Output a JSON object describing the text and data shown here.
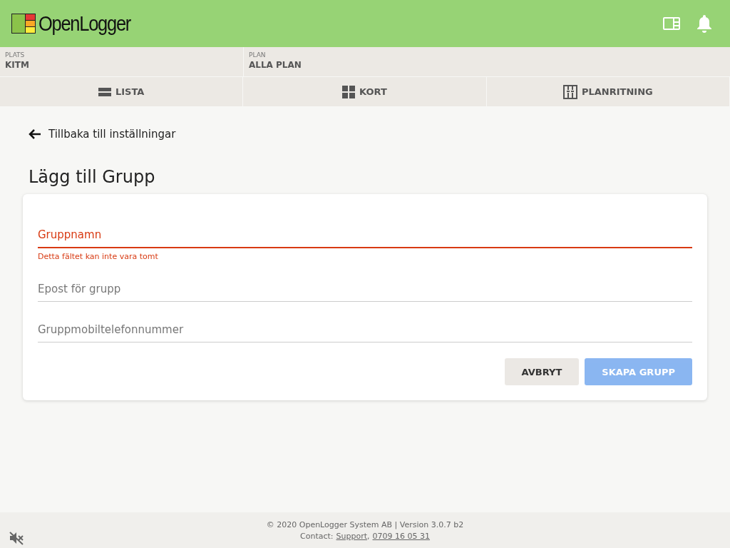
{
  "header": {
    "logo": "OpenLogger"
  },
  "context": [
    {
      "label": "PLATS",
      "value": "KITM"
    },
    {
      "label": "PLAN",
      "value": "ALLA PLAN"
    }
  ],
  "tabs": [
    {
      "kind": "list",
      "label": "LISTA",
      "selected": false
    },
    {
      "kind": "grid",
      "label": "KORT",
      "selected": false
    },
    {
      "kind": "plan",
      "label": "PLANRITNING",
      "selected": false
    }
  ],
  "back_link": "Tillbaka till inställningar",
  "title": "Lägg till Grupp",
  "fields": [
    {
      "placeholder": "Gruppnamn",
      "error": true,
      "error_text": "Detta fältet kan inte vara tomt"
    },
    {
      "placeholder": "Epost för grupp",
      "error": false
    },
    {
      "placeholder": "Gruppmobiltelefonnummer",
      "error": false
    }
  ],
  "buttons": [
    {
      "kind": "secondary",
      "label": "AVBRYT",
      "disabled": false
    },
    {
      "kind": "primary",
      "label": "SKAPA GRUPP",
      "disabled": true
    }
  ],
  "footer": {
    "copyright": "© 2020 OpenLogger System AB | Version 3.0.7 b2",
    "contact_label": "Contact:",
    "links": [
      "Support",
      "0709 16 05 31"
    ],
    "link_separator": ","
  }
}
